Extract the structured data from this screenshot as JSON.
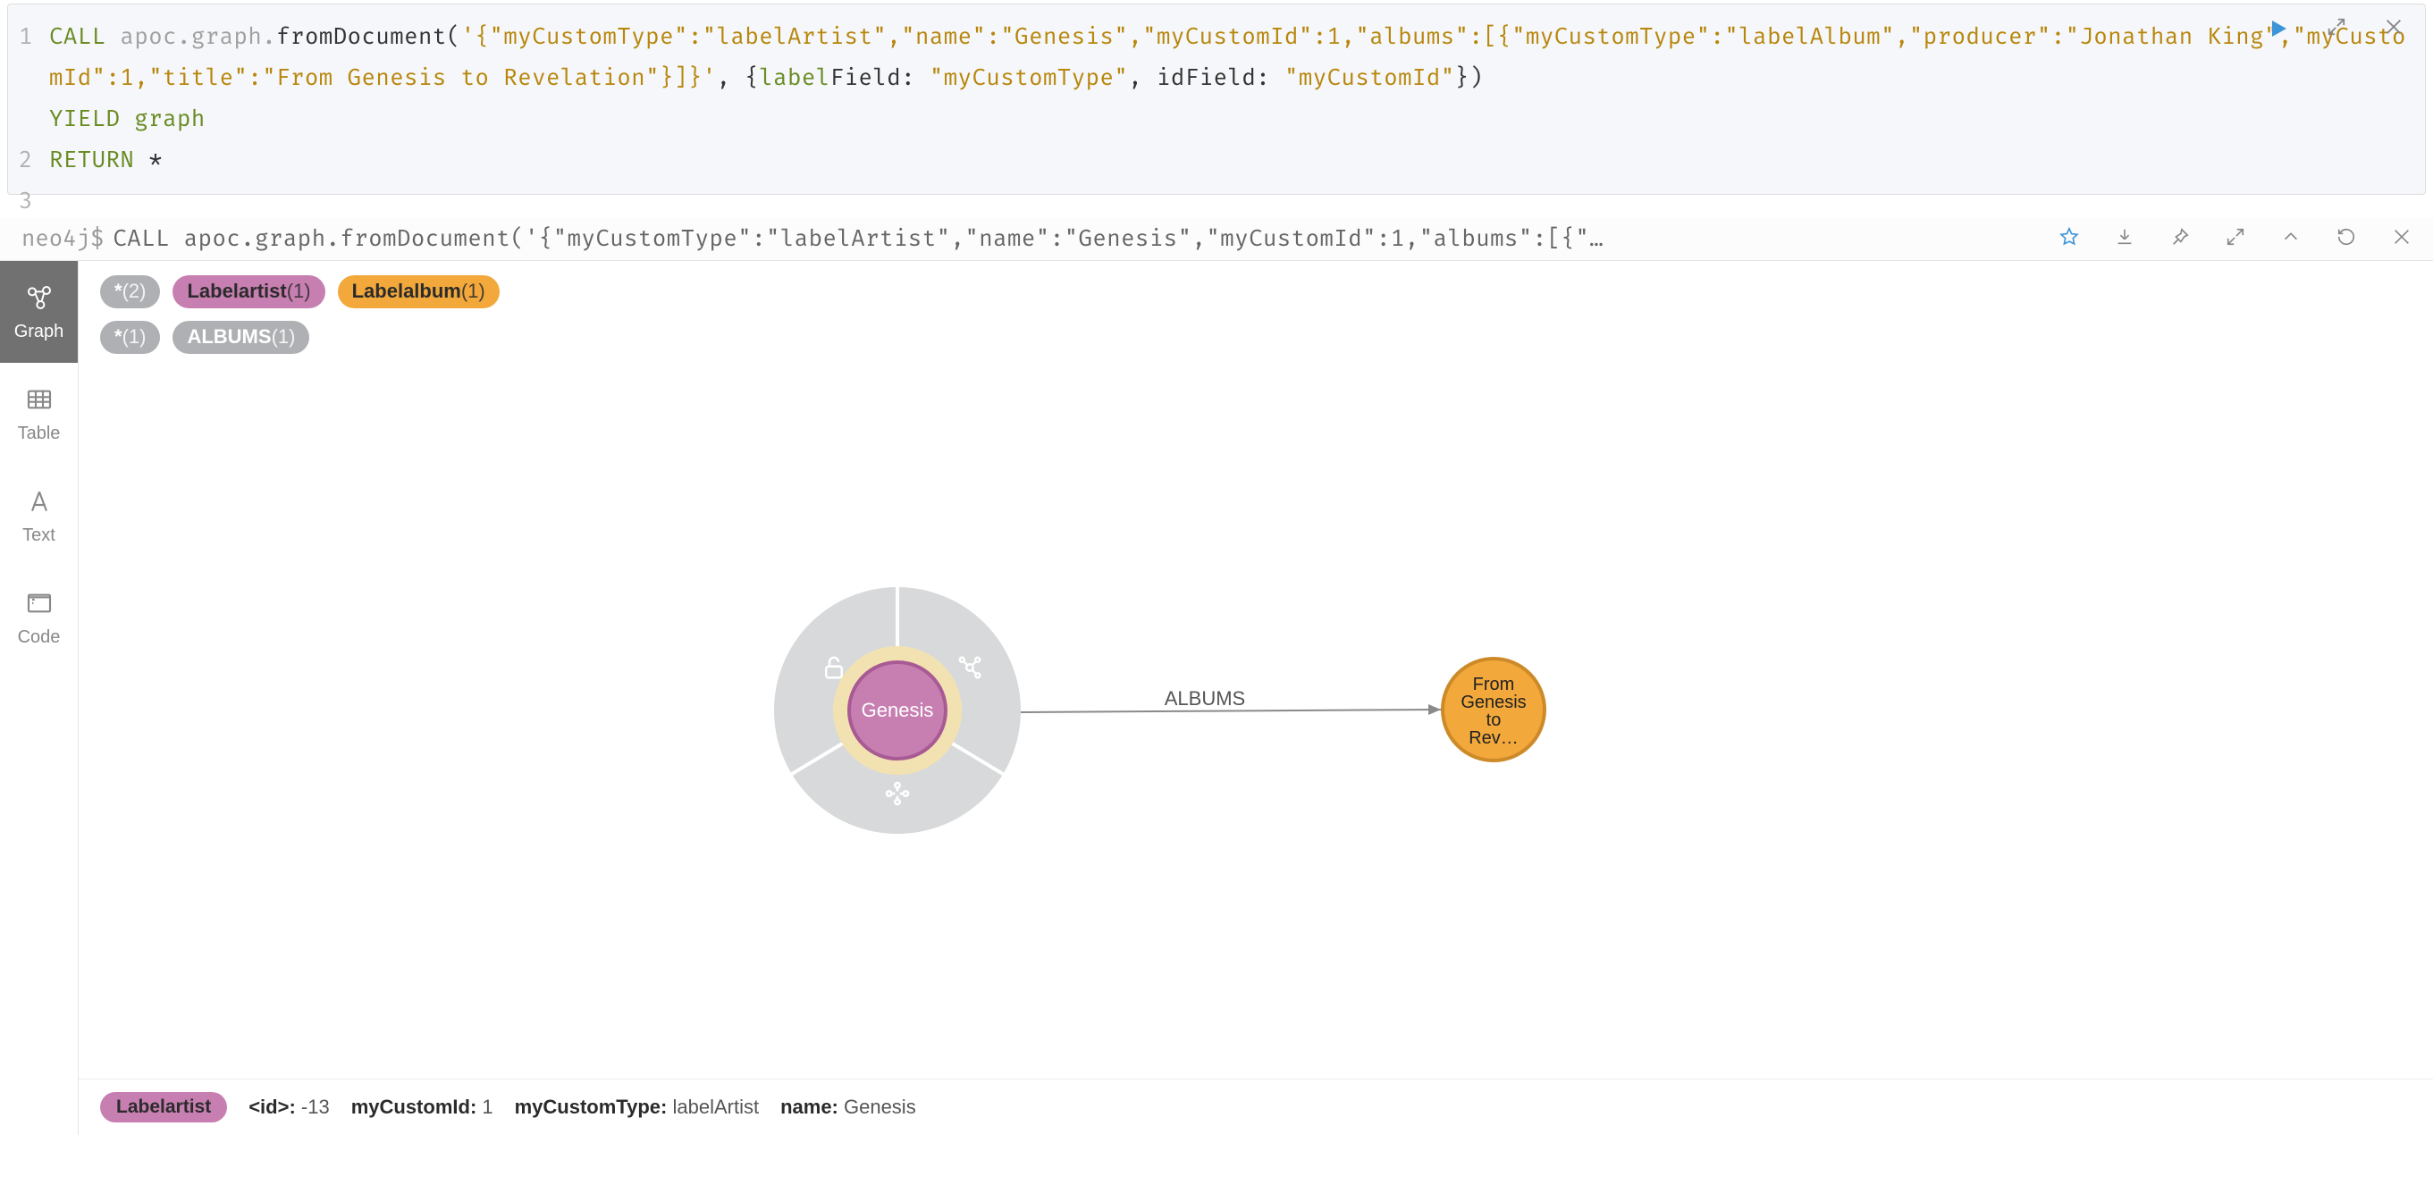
{
  "editor": {
    "line1_call": "CALL",
    "line1_ns": " apoc.graph.",
    "line1_fn": "fromDocument",
    "line1_paren": "(",
    "line1_str1": "'{\"myCustomType\":\"labelArtist\",\"name\":\"Genesis\",\"myCustomId\":1,\"albums\":[{\"myCustomType\":\"labelAlbum\",\"producer\":\"Jonathan King\",\"myCustomId\":1,\"title\":\"From Genesis to Revelation\"}]}'",
    "line1_comma": ", ",
    "line1_brace_open": "{",
    "line1_k1pre": "label",
    "line1_k1post": "Field: ",
    "line1_v1": "\"myCustomType\"",
    "line1_c2": ", idField: ",
    "line1_v2": "\"myCustomId\"",
    "line1_brace_close": "}",
    "line1_close": ")",
    "line2": "YIELD graph",
    "line3a": "RETURN",
    "line3b": " *",
    "nums": [
      "1",
      "2",
      "3"
    ]
  },
  "result_bar": {
    "prompt": "neo4j$",
    "query": "CALL apoc.graph.fromDocument('{\"myCustomType\":\"labelArtist\",\"name\":\"Genesis\",\"myCustomId\":1,\"albums\":[{\"…"
  },
  "sidebar": {
    "graph": "Graph",
    "table": "Table",
    "text": "Text",
    "code": "Code"
  },
  "chips": {
    "all_nodes": "*",
    "all_nodes_count": "(2)",
    "artist": "Labelartist",
    "artist_count": "(1)",
    "album": "Labelalbum",
    "album_count": "(1)",
    "all_rels": "*",
    "all_rels_count": "(1)",
    "rel": "ALBUMS",
    "rel_count": "(1)"
  },
  "graph": {
    "node1": "Genesis",
    "node2_l1": "From",
    "node2_l2": "Genesis",
    "node2_l3": "to",
    "node2_l4": "Rev…",
    "rel_label": "ALBUMS",
    "colors": {
      "artist_fill": "#c77fb2",
      "artist_ring": "#f1d99f",
      "album_fill": "#f2a83b",
      "album_stroke": "#cc8a28",
      "halo": "#d7d9da",
      "arrow": "#8a8a8a"
    }
  },
  "footer": {
    "badge": "Labelartist",
    "id_k": "<id>:",
    "id_v": " -13",
    "f1k": "myCustomId:",
    "f1v": " 1",
    "f2k": "myCustomType:",
    "f2v": " labelArtist",
    "f3k": "name:",
    "f3v": " Genesis"
  }
}
